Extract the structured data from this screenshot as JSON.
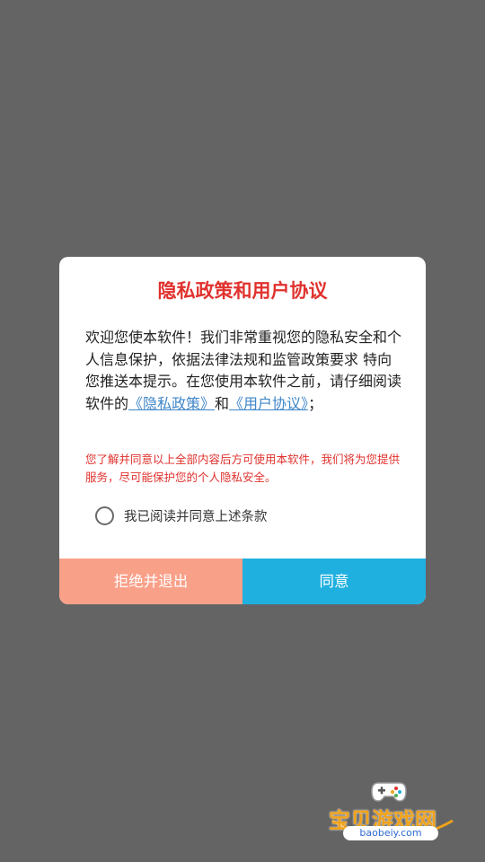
{
  "dialog": {
    "title": "隐私政策和用户协议",
    "body_intro": "欢迎您使本软件！我们非常重视您的隐私安全和个人信息保护，依据法律法规和监管政策要求 特向您推送本提示。在您使用本软件之前，请仔细阅读软件的",
    "privacy_link": "《隐私政策》",
    "connector": "和",
    "user_agreement_link": "《用户协议》",
    "body_end": "；",
    "warning": "您了解并同意以上全部内容后方可使用本软件，我们将为您提供服务，尽可能保护您的个人隐私安全。",
    "checkbox_label": "我已阅读并同意上述条款",
    "checkbox_checked": false,
    "reject_label": "拒绝并退出",
    "agree_label": "同意"
  },
  "colors": {
    "overlay": "#646464",
    "title": "#e0322e",
    "link": "#3f86c8",
    "reject_button": "#f9a089",
    "agree_button": "#20b0e0"
  },
  "watermark": {
    "text": "宝贝游戏网",
    "url": "baobeiy.com",
    "icon": "gamepad-icon"
  }
}
